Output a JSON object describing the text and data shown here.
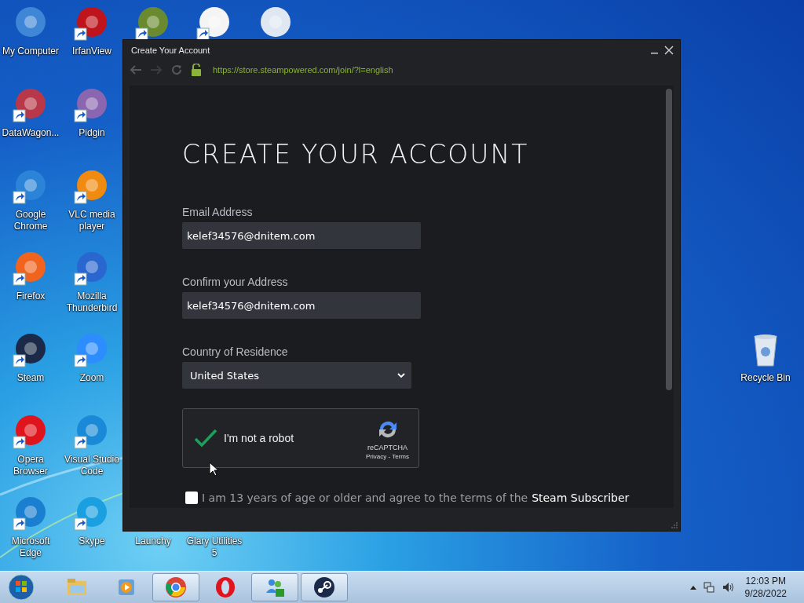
{
  "desktop": {
    "columns": [
      [
        {
          "kind": "icon",
          "label": "My Computer",
          "color": "#3f86d6",
          "shortcut": false
        },
        {
          "kind": "icon",
          "label": "DataWagon...",
          "color": "#b8384a",
          "shortcut": true
        },
        {
          "kind": "icon",
          "label": "Google Chrome",
          "color": "#2c84d8",
          "shortcut": true
        },
        {
          "kind": "icon",
          "label": "Firefox",
          "color": "#f0641e",
          "shortcut": true
        },
        {
          "kind": "icon",
          "label": "Steam",
          "color": "#1b2a48",
          "shortcut": true
        },
        {
          "kind": "icon",
          "label": "Opera Browser",
          "color": "#e0141c",
          "shortcut": true
        },
        {
          "kind": "icon",
          "label": "Microsoft Edge",
          "color": "#1a7fd0",
          "shortcut": true
        }
      ],
      [
        {
          "kind": "icon",
          "label": "IrfanView",
          "color": "#c0141c",
          "shortcut": true
        },
        {
          "kind": "icon",
          "label": "Pidgin",
          "color": "#8a66b0",
          "shortcut": true
        },
        {
          "kind": "icon",
          "label": "VLC media player",
          "color": "#f08a10",
          "shortcut": true
        },
        {
          "kind": "icon",
          "label": "Mozilla Thunderbird",
          "color": "#2a66d0",
          "shortcut": true
        },
        {
          "kind": "icon",
          "label": "Zoom",
          "color": "#2d8cff",
          "shortcut": true
        },
        {
          "kind": "icon",
          "label": "Visual Studio Code",
          "color": "#1a8ad8",
          "shortcut": true
        },
        {
          "kind": "icon",
          "label": "Skype",
          "color": "#1aa0e0",
          "shortcut": true
        }
      ],
      [
        {
          "kind": "icon",
          "color": "#6a8a30",
          "shortcut": true
        },
        {
          "kind": "label_only",
          "label": "Launchy"
        }
      ],
      [
        {
          "kind": "icon",
          "color": "#f4f4f4",
          "shortcut": true
        },
        {
          "kind": "label_only",
          "label": "Glary Utilities 5"
        }
      ],
      [
        {
          "kind": "icon",
          "color": "#dfe8f2",
          "shortcut": false
        }
      ]
    ],
    "recycle_bin": {
      "label": "Recycle Bin"
    }
  },
  "window": {
    "title": "Create Your Account",
    "url": "https://store.steampowered.com/join/?l=english",
    "secure": true,
    "heading": "CREATE YOUR ACCOUNT",
    "fields": [
      {
        "label": "Email Address",
        "value": "kelef34576@dnitem.com"
      },
      {
        "label": "Confirm your Address",
        "value": "kelef34576@dnitem.com"
      }
    ],
    "country": {
      "label": "Country of Residence",
      "value": "United States"
    },
    "captcha": {
      "label": "I'm not a robot",
      "checked": true,
      "brand": "reCAPTCHA",
      "links": "Privacy - Terms"
    },
    "agree": {
      "checked": false,
      "text": "I am 13 years of age or older and agree to the terms of the",
      "link": "Steam Subscriber"
    }
  },
  "taskbar": {
    "items": [
      {
        "kind": "folder",
        "running": false
      },
      {
        "kind": "media",
        "running": false
      },
      {
        "kind": "chrome",
        "running": true
      },
      {
        "kind": "opera",
        "running": false
      },
      {
        "kind": "people",
        "running": true
      },
      {
        "kind": "steam",
        "running": true
      }
    ],
    "clock": {
      "time": "12:03 PM",
      "date": "9/28/2022"
    }
  }
}
